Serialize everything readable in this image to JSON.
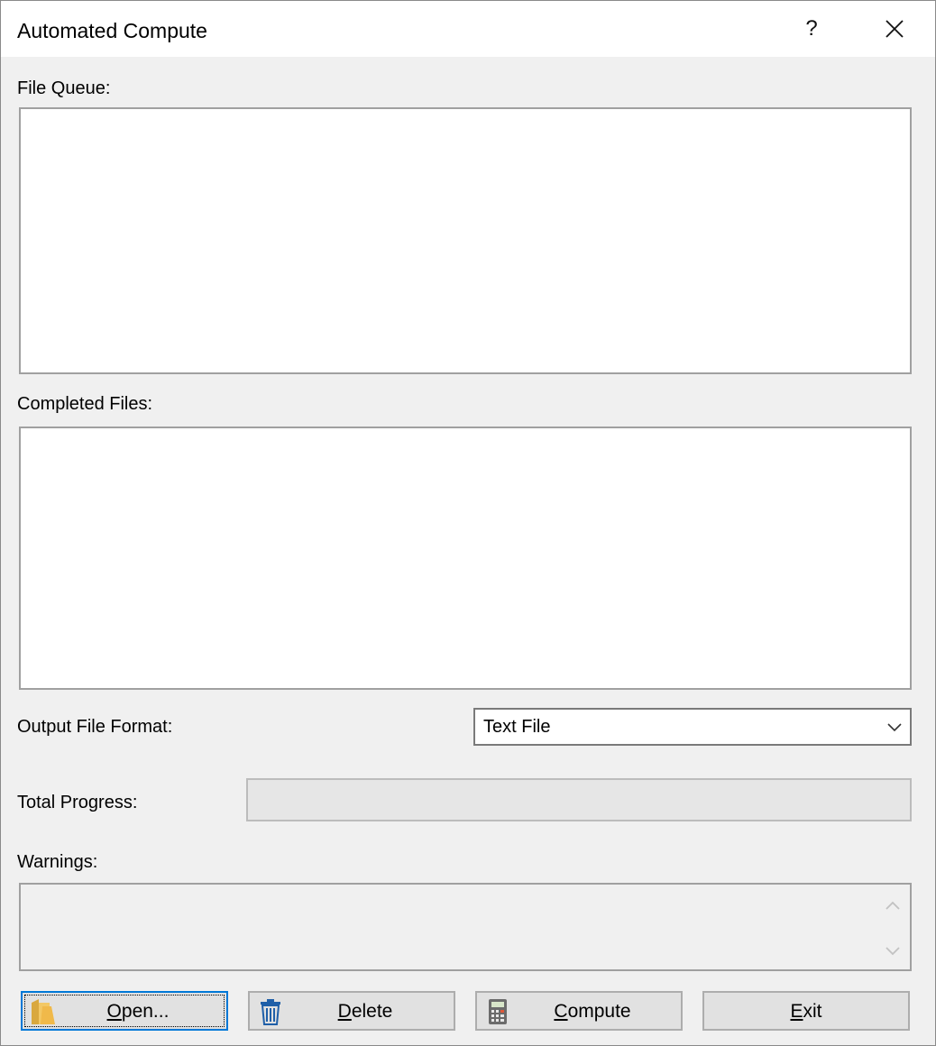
{
  "window": {
    "title": "Automated Compute",
    "help_label": "?",
    "close_label": "✕"
  },
  "file_queue": {
    "label": "File Queue:",
    "items": []
  },
  "completed_files": {
    "label": "Completed Files:",
    "items": []
  },
  "output_format": {
    "label": "Output File Format:",
    "selected": "Text File"
  },
  "total_progress": {
    "label": "Total Progress:",
    "value_percent": 0
  },
  "warnings": {
    "label": "Warnings:",
    "text": ""
  },
  "buttons": {
    "open": "Open...",
    "delete": "Delete",
    "compute": "Compute",
    "exit": "Exit"
  },
  "icons": {
    "open": "folder-icon",
    "delete": "trash-icon",
    "compute": "calculator-icon",
    "dropdown": "chevron-down-icon",
    "scroll_up": "chevron-up-icon",
    "scroll_down": "chevron-down-icon"
  },
  "colors": {
    "accent": "#0078d7",
    "progress_fill": "#06b025"
  }
}
